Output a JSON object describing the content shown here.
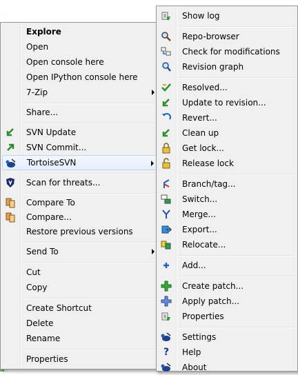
{
  "main_menu": {
    "explore": "Explore",
    "open": "Open",
    "open_console": "Open console here",
    "open_ipython": "Open IPython console here",
    "seven_zip": "7-Zip",
    "share": "Share...",
    "svn_update": "SVN Update",
    "svn_commit": "SVN Commit...",
    "tortoisesvn": "TortoiseSVN",
    "scan": "Scan for threats...",
    "compare_to": "Compare To",
    "compare": "Compare...",
    "restore": "Restore previous versions",
    "send_to": "Send To",
    "cut": "Cut",
    "copy": "Copy",
    "create_shortcut": "Create Shortcut",
    "delete": "Delete",
    "rename": "Rename",
    "properties": "Properties"
  },
  "sub_menu": {
    "show_log": "Show log",
    "repo_browser": "Repo-browser",
    "check_mods": "Check for modifications",
    "revision_graph": "Revision graph",
    "resolved": "Resolved...",
    "update_revision": "Update to revision...",
    "revert": "Revert...",
    "clean_up": "Clean up",
    "get_lock": "Get lock...",
    "release_lock": "Release lock",
    "branch_tag": "Branch/tag...",
    "switch": "Switch...",
    "merge": "Merge...",
    "export": "Export...",
    "relocate": "Relocate...",
    "add": "Add...",
    "create_patch": "Create patch...",
    "apply_patch": "Apply patch...",
    "properties": "Properties",
    "settings": "Settings",
    "help": "Help",
    "about": "About"
  },
  "icons": {
    "svn_update": "green-arrow-down-left-icon",
    "svn_commit": "green-arrow-up-right-icon",
    "tortoisesvn": "tortoise-icon",
    "scan": "shield-icon",
    "compare": "compare-files-icon"
  },
  "colors": {
    "menu_bg": "#f0f0f0",
    "highlight_border": "#b8d6fb",
    "green": "#2e8b2e",
    "blue": "#2060c0"
  }
}
